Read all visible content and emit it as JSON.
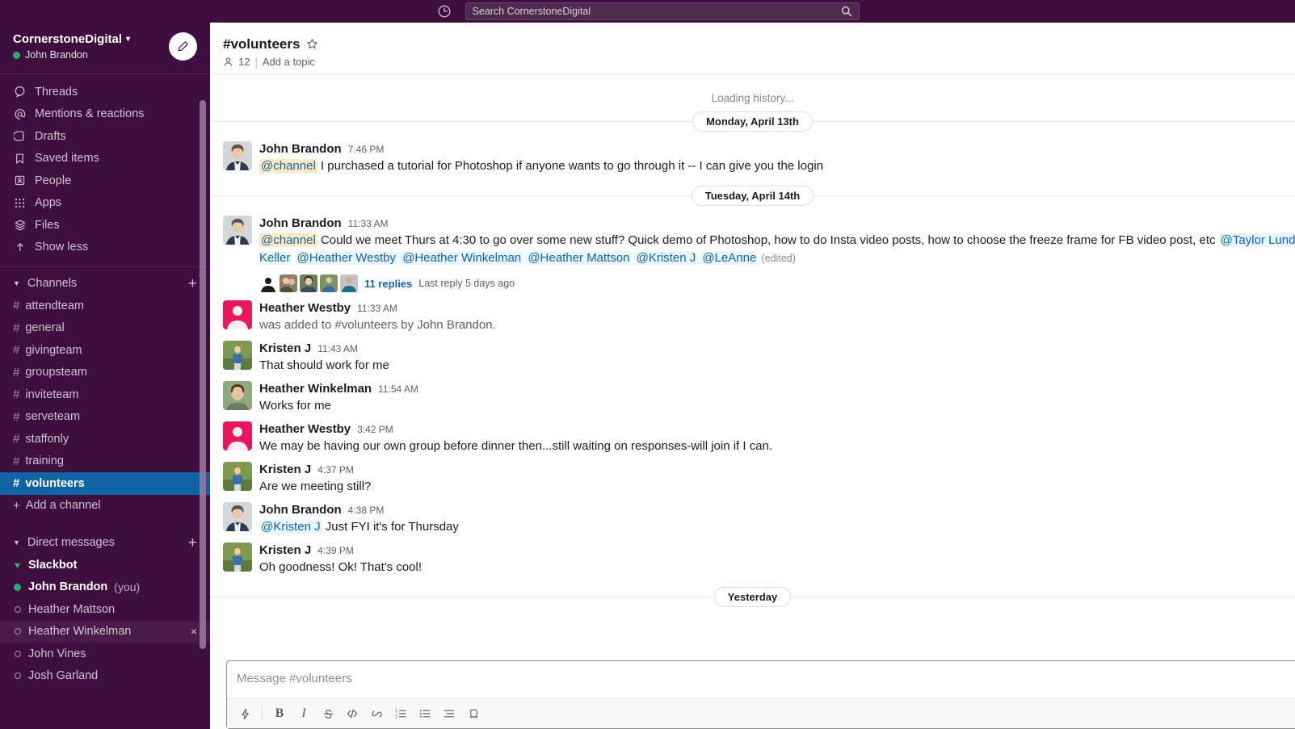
{
  "topbar": {
    "history_icon": "clock-icon",
    "search_placeholder": "Search CornerstoneDigital",
    "search_value": "",
    "search_icon": "search-icon"
  },
  "sidebar": {
    "workspace_name": "CornerstoneDigital",
    "user_name": "John Brandon",
    "compose_icon": "compose-pencil-icon",
    "nav_items": [
      {
        "label": "Threads",
        "icon": "threads-icon"
      },
      {
        "label": "Mentions & reactions",
        "icon": "at-icon"
      },
      {
        "label": "Drafts",
        "icon": "drafts-icon"
      },
      {
        "label": "Saved items",
        "icon": "bookmark-icon"
      },
      {
        "label": "People",
        "icon": "people-icon"
      },
      {
        "label": "Apps",
        "icon": "apps-grid-icon"
      },
      {
        "label": "Files",
        "icon": "files-stack-icon"
      },
      {
        "label": "Show less",
        "icon": "arrow-up-icon"
      }
    ],
    "channels_section": {
      "label": "Channels",
      "add_label": "+",
      "items": [
        {
          "name": "attendteam",
          "active": false
        },
        {
          "name": "general",
          "active": false
        },
        {
          "name": "givingteam",
          "active": false
        },
        {
          "name": "groupsteam",
          "active": false
        },
        {
          "name": "inviteteam",
          "active": false
        },
        {
          "name": "serveteam",
          "active": false
        },
        {
          "name": "staffonly",
          "active": false
        },
        {
          "name": "training",
          "active": false
        },
        {
          "name": "volunteers",
          "active": true
        }
      ],
      "add_channel_label": "Add a channel"
    },
    "dm_section": {
      "label": "Direct messages",
      "add_label": "+",
      "items": [
        {
          "name": "Slackbot",
          "status": "heart",
          "bold": true,
          "suffix": ""
        },
        {
          "name": "John Brandon",
          "status": "online",
          "bold": true,
          "suffix": "(you)"
        },
        {
          "name": "Heather Mattson",
          "status": "away",
          "bold": false,
          "suffix": ""
        },
        {
          "name": "Heather Winkelman",
          "status": "away",
          "bold": false,
          "suffix": "",
          "hovered": true,
          "close": "×"
        },
        {
          "name": "John Vines",
          "status": "away",
          "bold": false,
          "suffix": ""
        },
        {
          "name": "Josh Garland",
          "status": "away",
          "bold": false,
          "suffix": ""
        }
      ]
    }
  },
  "channel_header": {
    "title": "#volunteers",
    "star_icon": "star-outline-icon",
    "member_icon": "member-icon",
    "member_count": "12",
    "separator": "|",
    "topic_label": "Add a topic"
  },
  "messages": {
    "loading_text": "Loading history...",
    "dividers": {
      "first": "Monday, April 13th",
      "second": "Tuesday, April 14th",
      "third": "Yesterday"
    },
    "list": [
      {
        "author": "John Brandon",
        "time": "7:46 PM",
        "avatar": "john-brandon-avatar",
        "segments": [
          {
            "type": "mention-channel",
            "text": "@channel"
          },
          {
            "type": "plain",
            "text": " I purchased a tutorial for Photoshop if anyone wants to go through it -- I can give you the login"
          }
        ]
      },
      {
        "author": "John Brandon",
        "time": "11:33 AM",
        "avatar": "john-brandon-avatar",
        "segments": [
          {
            "type": "mention-channel",
            "text": "@channel"
          },
          {
            "type": "plain",
            "text": " Could we meet Thurs at 4:30 to go over some new stuff? Quick demo of Photoshop, how to do Insta video posts, how to choose the freeze frame for FB video post, etc "
          },
          {
            "type": "mention-user",
            "text": "@Taylor Lundeen Keller"
          },
          {
            "type": "plain",
            "text": " "
          },
          {
            "type": "mention-user",
            "text": "@Heather Westby"
          },
          {
            "type": "plain",
            "text": " "
          },
          {
            "type": "mention-user",
            "text": "@Heather Winkelman"
          },
          {
            "type": "plain",
            "text": " "
          },
          {
            "type": "mention-user",
            "text": "@Heather Mattson"
          },
          {
            "type": "plain",
            "text": " "
          },
          {
            "type": "mention-user",
            "text": "@Kristen J"
          },
          {
            "type": "plain",
            "text": " "
          },
          {
            "type": "mention-user",
            "text": "@LeAnne"
          },
          {
            "type": "plain",
            "text": " "
          },
          {
            "type": "edited",
            "text": "(edited)"
          }
        ],
        "thread": {
          "replies_label": "11 replies",
          "last_reply": "Last reply 5 days ago",
          "avatars": [
            "reply-avatar-1",
            "reply-avatar-2",
            "reply-avatar-3",
            "reply-avatar-4",
            "reply-avatar-5"
          ]
        }
      },
      {
        "author": "Heather Westby",
        "time": "11:33 AM",
        "avatar": "heather-westby-avatar",
        "system": true,
        "segments": [
          {
            "type": "plain",
            "text": "was added to #volunteers by John Brandon."
          }
        ]
      },
      {
        "author": "Kristen J",
        "time": "11:43 AM",
        "avatar": "kristen-j-avatar",
        "segments": [
          {
            "type": "plain",
            "text": "That should work for me"
          }
        ]
      },
      {
        "author": "Heather Winkelman",
        "time": "11:54 AM",
        "avatar": "heather-winkelman-avatar",
        "segments": [
          {
            "type": "plain",
            "text": "Works for me"
          }
        ]
      },
      {
        "author": "Heather Westby",
        "time": "3:42 PM",
        "avatar": "heather-westby-avatar",
        "segments": [
          {
            "type": "plain",
            "text": "We may be having our own group before dinner then...still waiting on responses-will join if I can."
          }
        ]
      },
      {
        "author": "Kristen J",
        "time": "4:37 PM",
        "avatar": "kristen-j-avatar",
        "segments": [
          {
            "type": "plain",
            "text": "Are we meeting still?"
          }
        ]
      },
      {
        "author": "John Brandon",
        "time": "4:38 PM",
        "avatar": "john-brandon-avatar",
        "segments": [
          {
            "type": "mention-user",
            "text": "@Kristen J"
          },
          {
            "type": "plain",
            "text": " Just FYI it's for Thursday"
          }
        ]
      },
      {
        "author": "Kristen J",
        "time": "4:39 PM",
        "avatar": "kristen-j-avatar",
        "segments": [
          {
            "type": "plain",
            "text": "Oh goodness! Ok! That's cool!"
          }
        ]
      }
    ]
  },
  "composer": {
    "placeholder": "Message #volunteers",
    "value": "",
    "toolbar": [
      {
        "name": "shortcuts-lightning-icon",
        "glyph": "lightning"
      },
      {
        "name": "bold-button",
        "glyph": "B"
      },
      {
        "name": "italic-button",
        "glyph": "I"
      },
      {
        "name": "strikethrough-button",
        "glyph": "S"
      },
      {
        "name": "code-button",
        "glyph": "</>"
      },
      {
        "name": "link-button",
        "glyph": "link"
      },
      {
        "name": "ordered-list-button",
        "glyph": "ol"
      },
      {
        "name": "bulleted-list-button",
        "glyph": "ul"
      },
      {
        "name": "blockquote-button",
        "glyph": "quote"
      },
      {
        "name": "code-block-button",
        "glyph": "codeblock"
      }
    ]
  },
  "colors": {
    "sidebar_bg": "#3F0E40",
    "active_channel": "#1164A3",
    "link_blue": "#1264A3",
    "mention_channel_bg": "#FBEAC2",
    "mention_user_bg": "#E8F5FA",
    "presence_green": "#2BAC76",
    "text_primary": "#1D1C1D",
    "text_secondary": "#616061"
  }
}
